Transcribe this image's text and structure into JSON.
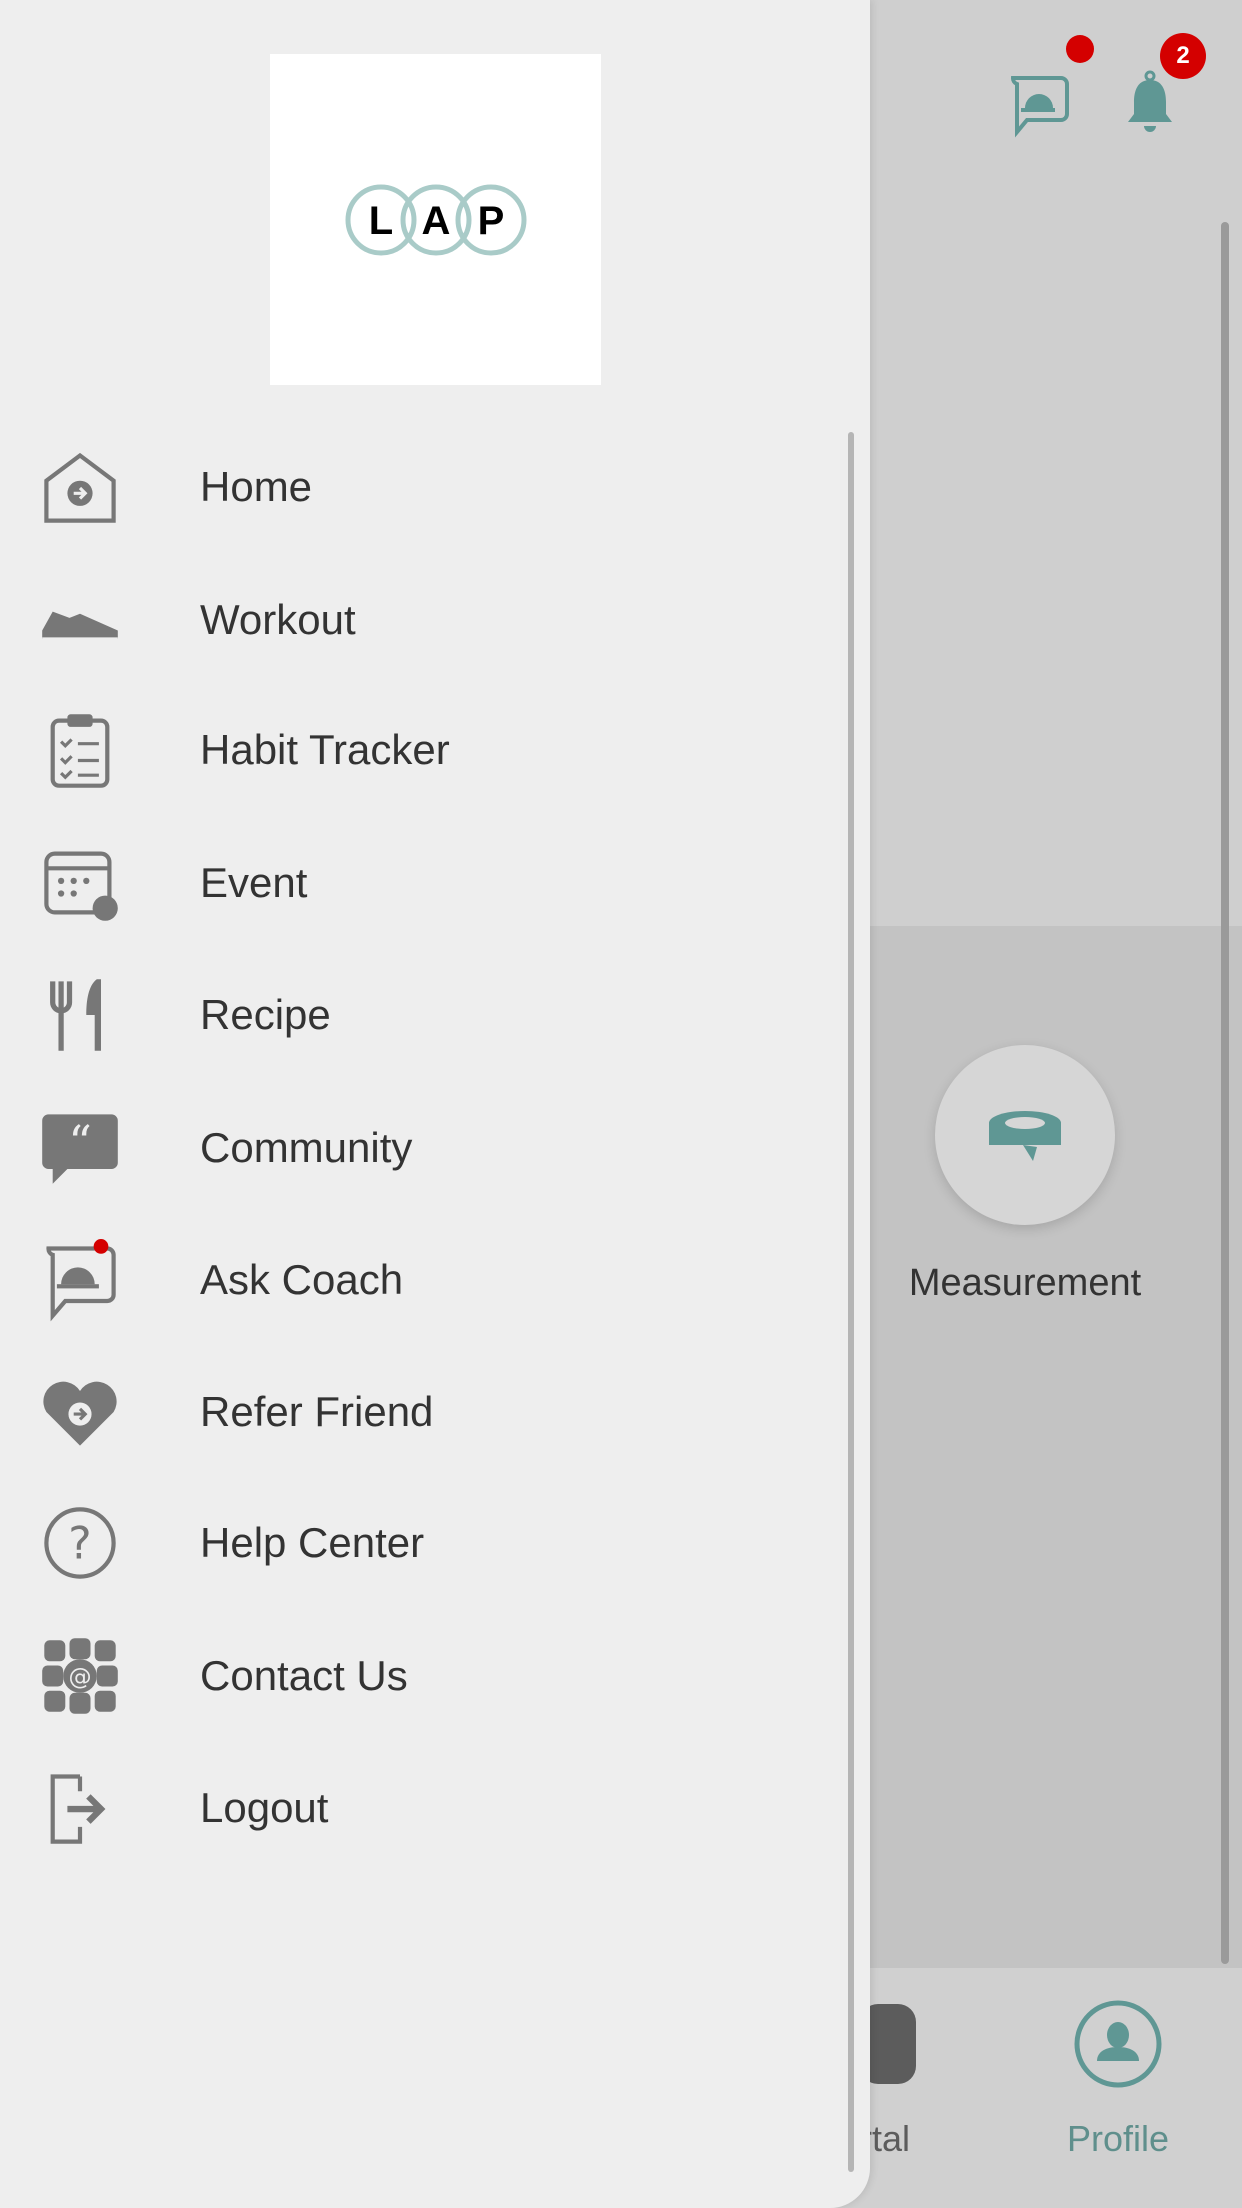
{
  "header": {
    "ask_coach_icon": "ask-coach-icon",
    "notifications_icon": "bell-icon",
    "notification_count": "2",
    "accent": "#5f9794",
    "badge_color": "#d40000"
  },
  "content": {
    "measurement_label": "Measurement",
    "measurement_icon": "tape-measure-icon"
  },
  "bottom_nav": {
    "portal_label_partial": "rtal",
    "profile_label": "Profile"
  },
  "drawer": {
    "logo_letters": [
      "L",
      "A",
      "P"
    ],
    "items": [
      {
        "label": "Home",
        "icon": "home-icon"
      },
      {
        "label": "Workout",
        "icon": "sneaker-icon"
      },
      {
        "label": "Habit Tracker",
        "icon": "clipboard-checklist-icon"
      },
      {
        "label": "Event",
        "icon": "calendar-icon"
      },
      {
        "label": "Recipe",
        "icon": "fork-knife-icon"
      },
      {
        "label": "Community",
        "icon": "quote-bubble-icon"
      },
      {
        "label": "Ask Coach",
        "icon": "ask-coach-icon"
      },
      {
        "label": "Refer Friend",
        "icon": "heart-arrow-icon"
      },
      {
        "label": "Help Center",
        "icon": "question-icon"
      },
      {
        "label": "Contact Us",
        "icon": "at-sign-icon"
      },
      {
        "label": "Logout",
        "icon": "logout-icon"
      }
    ]
  }
}
